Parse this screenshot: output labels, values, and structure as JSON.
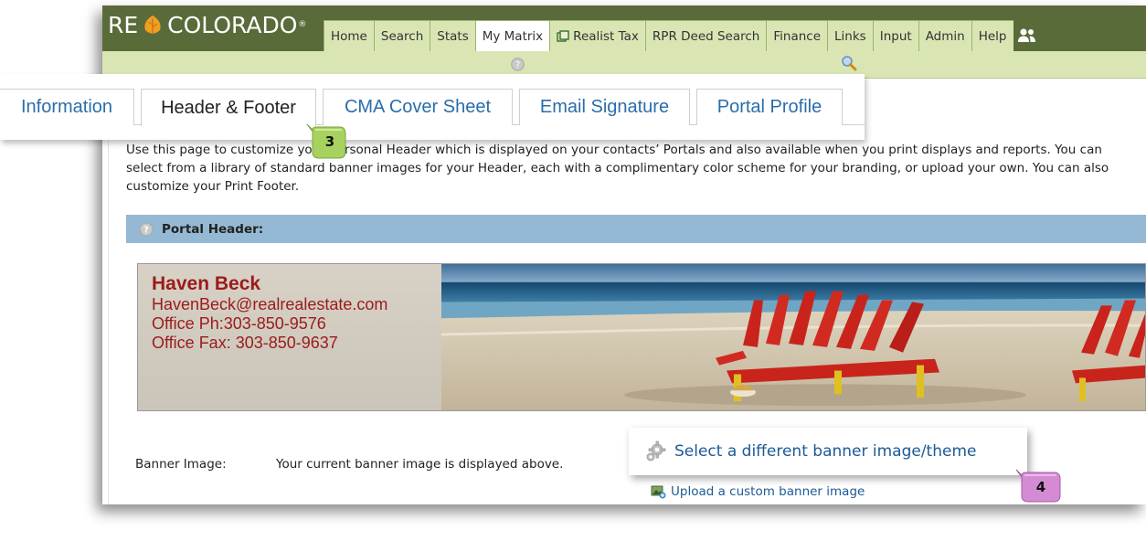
{
  "app": {
    "logo_left": "RE",
    "logo_right": "COLORADO",
    "logo_reg": "®"
  },
  "nav": {
    "items": [
      {
        "label": "Home",
        "active": false
      },
      {
        "label": "Search",
        "active": false
      },
      {
        "label": "Stats",
        "active": false
      },
      {
        "label": "My Matrix",
        "active": true
      },
      {
        "label": "Realist Tax",
        "active": false,
        "icon": "window-icon"
      },
      {
        "label": "RPR Deed Search",
        "active": false
      },
      {
        "label": "Finance",
        "active": false
      },
      {
        "label": "Links",
        "active": false
      },
      {
        "label": "Input",
        "active": false
      },
      {
        "label": "Admin",
        "active": false
      },
      {
        "label": "Help",
        "active": false
      }
    ],
    "user_icon": "users-icon"
  },
  "tabs": [
    {
      "label": "Information",
      "active": false
    },
    {
      "label": "Header & Footer",
      "active": true
    },
    {
      "label": "CMA Cover Sheet",
      "active": false
    },
    {
      "label": "Email Signature",
      "active": false
    },
    {
      "label": "Portal Profile",
      "active": false
    }
  ],
  "description": "Use this page to customize your personal Header which is displayed on your contacts’ Portals and also available when you print displays and reports. You can select from a library of standard banner images for your Header, each with a complimentary color scheme for your branding, or upload your own. You can also customize your Print Footer.",
  "portal_header": {
    "title": "Portal Header:"
  },
  "banner": {
    "name": "Haven Beck",
    "email": "HavenBeck@realrealestate.com",
    "office_ph": "Office Ph:303-850-9576",
    "office_fax": "Office Fax: 303-850-9637"
  },
  "banner_image": {
    "label": "Banner Image:",
    "current_text": "Your current banner image is displayed above.",
    "select_link": "Select a different banner image/theme",
    "upload_link": "Upload a custom banner image"
  },
  "badges": {
    "step3": "3",
    "step4": "4"
  },
  "colors": {
    "topbar": "#5a6b3a",
    "nav_tab": "#d9e6b4",
    "link": "#1c5a96",
    "section_bar": "#95b9d4",
    "agent_text": "#9b1b1b",
    "badge": "#a7d25f",
    "badge4": "#d48bd4"
  }
}
